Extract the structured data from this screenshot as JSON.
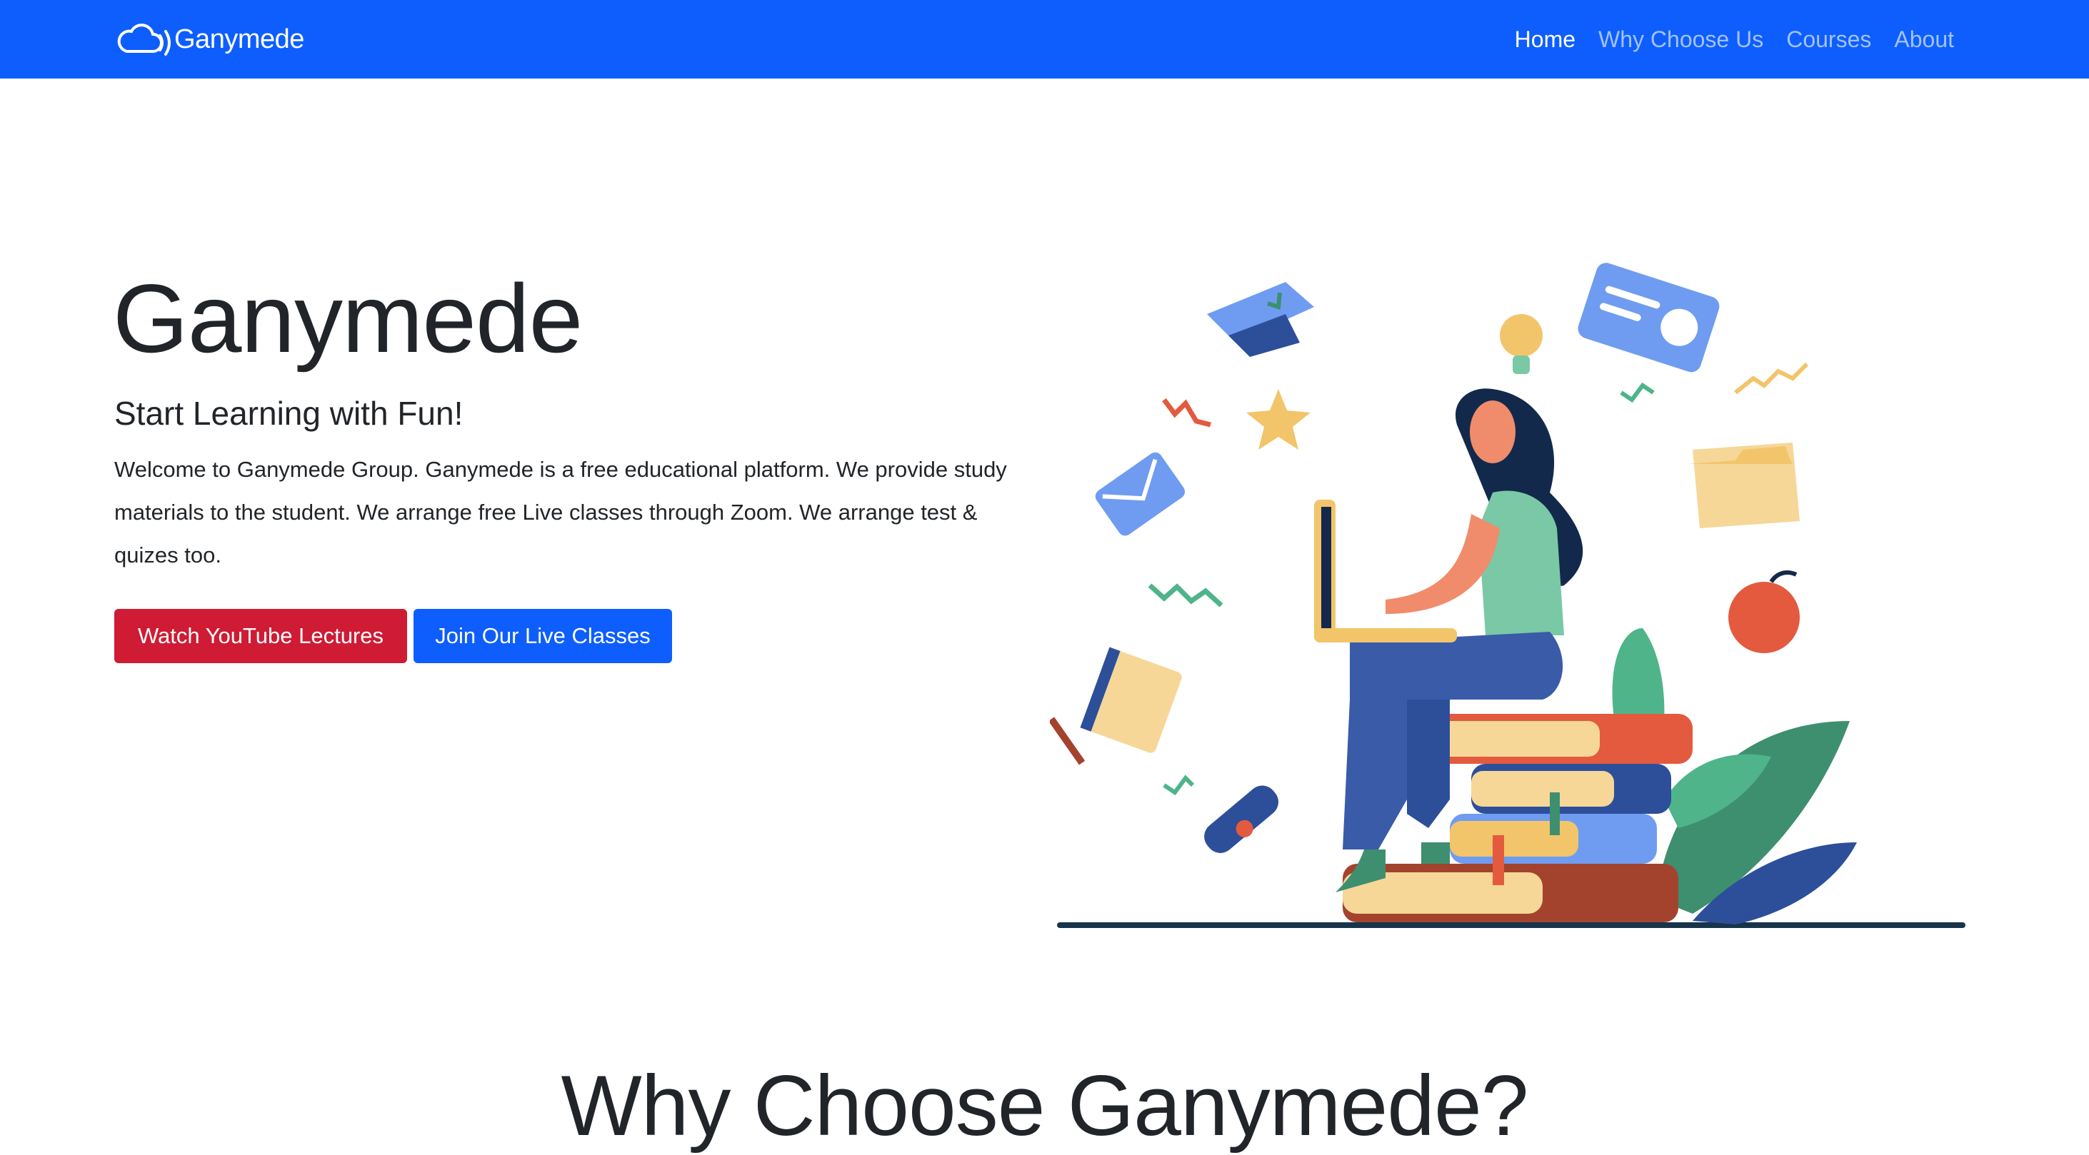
{
  "navbar": {
    "brand": "Ganymede",
    "brand_icon": "cloud-broadcast-icon",
    "links": [
      {
        "label": "Home",
        "active": true
      },
      {
        "label": "Why Choose Us",
        "active": false
      },
      {
        "label": "Courses",
        "active": false
      },
      {
        "label": "About",
        "active": false
      }
    ]
  },
  "hero": {
    "title": "Ganymede",
    "subtitle": "Start Learning with Fun!",
    "text": "Welcome to Ganymede Group. Ganymede is a free educational platform. We provide study materials to the student. We arrange free Live classes through Zoom. We arrange test & quizes too.",
    "buttons": {
      "youtube": "Watch YouTube Lectures",
      "live": "Join Our Live Classes"
    }
  },
  "section": {
    "title": "Why Choose Ganymede?"
  },
  "colors": {
    "primary": "#0d5efd",
    "danger": "#cf1b34",
    "text": "#212529"
  }
}
